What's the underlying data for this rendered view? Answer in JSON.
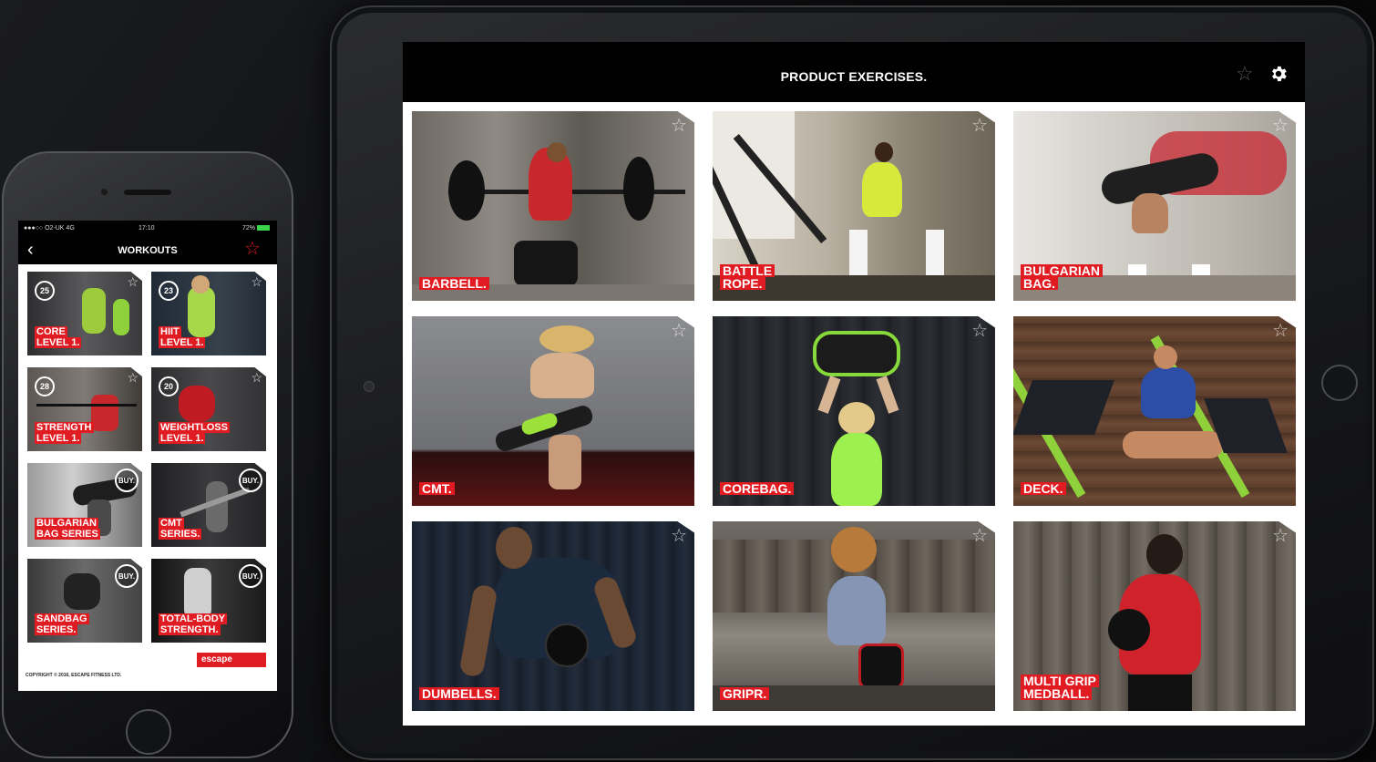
{
  "tablet": {
    "title": "PRODUCT EXERCISES.",
    "favorite_icon": "star-outline-icon",
    "settings_icon": "gear-icon",
    "tiles": [
      {
        "label": [
          "BARBELL."
        ]
      },
      {
        "label": [
          "BATTLE",
          "ROPE."
        ]
      },
      {
        "label": [
          "BULGARIAN",
          "BAG."
        ]
      },
      {
        "label": [
          "CMT."
        ]
      },
      {
        "label": [
          "COREBAG."
        ]
      },
      {
        "label": [
          "DECK."
        ]
      },
      {
        "label": [
          "DUMBELLS."
        ]
      },
      {
        "label": [
          "GRIPR."
        ]
      },
      {
        "label": [
          "MULTI GRIP",
          "MEDBALL."
        ]
      }
    ]
  },
  "phone": {
    "status": {
      "carrier": "●●●○○ O2-UK  4G",
      "time": "17:10",
      "battery": "72%"
    },
    "nav_title": "WORKOUTS",
    "back_icon": "chevron-left-icon",
    "favorite_icon": "star-outline-icon",
    "tiles": [
      {
        "label": [
          "CORE",
          "LEVEL 1."
        ],
        "badge": "25",
        "buy": ""
      },
      {
        "label": [
          "HIIT",
          "LEVEL 1."
        ],
        "badge": "23",
        "buy": ""
      },
      {
        "label": [
          "STRENGTH",
          "LEVEL 1."
        ],
        "badge": "28",
        "buy": ""
      },
      {
        "label": [
          "WEIGHTLOSS",
          "LEVEL 1."
        ],
        "badge": "20",
        "buy": ""
      },
      {
        "label": [
          "BULGARIAN",
          "BAG SERIES"
        ],
        "badge": "",
        "buy": "BUY."
      },
      {
        "label": [
          "CMT",
          "SERIES."
        ],
        "badge": "",
        "buy": "BUY."
      },
      {
        "label": [
          "SANDBAG",
          "SERIES."
        ],
        "badge": "",
        "buy": "BUY."
      },
      {
        "label": [
          "TOTAL-BODY",
          "STRENGTH."
        ],
        "badge": "",
        "buy": "BUY."
      }
    ],
    "logo": "escape",
    "copyright": "COPYRIGHT © 2016, ESCAPE FITNESS LTD."
  },
  "colors": {
    "accent": "#e01b22",
    "header": "#000000",
    "device_frame": "#1c1d20"
  }
}
